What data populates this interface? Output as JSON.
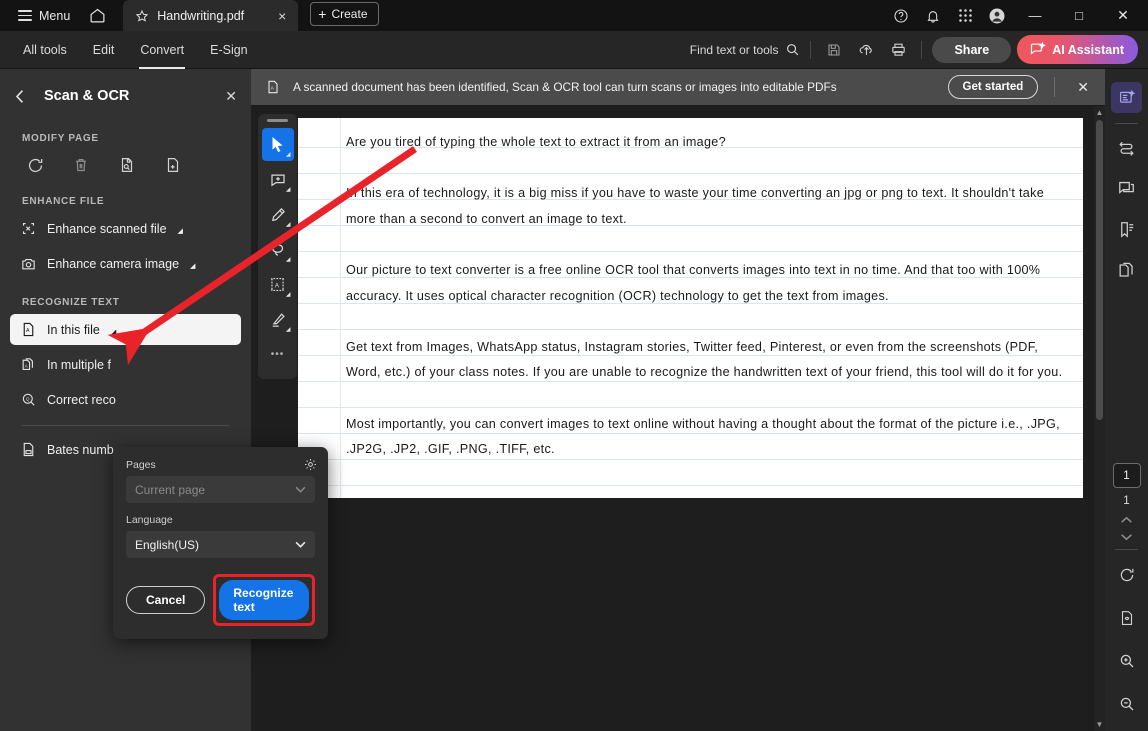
{
  "titlebar": {
    "menu_label": "Menu",
    "home_icon": "home-icon",
    "tab": {
      "star_icon": "star-icon",
      "title": "Handwriting.pdf",
      "close": "×"
    },
    "create_label": "Create",
    "plus": "+",
    "right_icons": [
      "help-icon",
      "bell-icon",
      "apps-grid-icon",
      "account-avatar-icon"
    ],
    "window_controls": {
      "minimize": "—",
      "maximize": "□",
      "close": "✕"
    }
  },
  "toolbar": {
    "tabs": [
      {
        "label": "All tools",
        "active": false
      },
      {
        "label": "Edit",
        "active": false
      },
      {
        "label": "Convert",
        "active": true
      },
      {
        "label": "E-Sign",
        "active": false
      }
    ],
    "find_label": "Find text or tools",
    "search_icon": "search-icon",
    "save_icon": "save-icon",
    "upload_icon": "cloud-upload-icon",
    "print_icon": "print-icon",
    "share_label": "Share",
    "ai_label": "AI Assistant",
    "ai_icon": "ai-sparkle-icon",
    "accent_blue": "#1473e6",
    "highlight_red": "#e8242a"
  },
  "left_panel": {
    "back_icon": "chevron-left-icon",
    "title": "Scan & OCR",
    "close": "✕",
    "sections": [
      {
        "label": "MODIFY PAGE",
        "icons": [
          "rotate-page-icon",
          "delete-page-icon",
          "replace-page-icon",
          "insert-page-icon"
        ]
      },
      {
        "label": "ENHANCE FILE",
        "items": [
          {
            "label": "Enhance scanned file",
            "icon": "enhance-scan-icon",
            "caret": true
          },
          {
            "label": "Enhance camera image",
            "icon": "camera-icon",
            "caret": true
          }
        ]
      },
      {
        "label": "RECOGNIZE TEXT",
        "items": [
          {
            "label": "In this file",
            "icon": "recognize-file-icon",
            "caret": true,
            "selected": true
          },
          {
            "label": "In multiple f",
            "icon": "recognize-multi-icon",
            "caret": false,
            "selected": false
          },
          {
            "label": "Correct reco",
            "icon": "correct-recognition-icon",
            "caret": false,
            "selected": false
          }
        ]
      },
      {
        "label": "",
        "items": [
          {
            "label": "Bates numb",
            "icon": "bates-numbering-icon",
            "caret": false,
            "selected": false
          }
        ]
      }
    ]
  },
  "popup": {
    "gear_icon": "gear-icon",
    "pages_label": "Pages",
    "pages_value": "Current page",
    "language_label": "Language",
    "language_value": "English(US)",
    "cancel_label": "Cancel",
    "recognize_label": "Recognize text",
    "chevron": "⌄"
  },
  "banner": {
    "icon": "scanned-doc-icon",
    "text": "A scanned document has been identified, Scan & OCR tool can turn scans or images into editable PDFs",
    "button_label": "Get started",
    "close": "✕"
  },
  "viewer_tools": [
    {
      "name": "select-cursor-tool",
      "active": true,
      "caret": true
    },
    {
      "name": "add-comment-tool",
      "active": false,
      "caret": true
    },
    {
      "name": "highlight-pen-tool",
      "active": false,
      "caret": true
    },
    {
      "name": "lasso-erase-tool",
      "active": false,
      "caret": true
    },
    {
      "name": "text-select-tool",
      "active": false,
      "caret": true
    },
    {
      "name": "stamp-signature-tool",
      "active": false,
      "caret": true
    },
    {
      "name": "more-tools",
      "active": false,
      "caret": false,
      "glyph": "•••"
    }
  ],
  "document": {
    "paragraphs": [
      "Are you tired of typing the whole text to extract it from an image?",
      "In this era of technology, it is a big miss if you have to waste your time converting an jpg or png to text. It shouldn't take more than a second to convert an image to text.",
      "Our picture to text converter is a free online OCR tool that converts images into text in no time. And that too with 100% accuracy. It uses optical character recognition (OCR) technology to get the text from images.",
      "Get text from Images, WhatsApp status, Instagram stories, Twitter feed, Pinterest, or even from the screenshots (PDF, Word, etc.) of your class notes. If you are unable to recognize the handwritten text of your friend, this tool will do it for you.",
      "Most importantly, you can convert images to text online without having a thought about the format of the picture i.e., .JPG, .JP2G, .JP2, .GIF, .PNG, .TIFF, etc."
    ]
  },
  "right_rail": {
    "top_icons": [
      {
        "name": "ai-assistant-panel-icon",
        "active": true
      },
      {
        "name": "convert-arrows-icon",
        "active": false
      },
      {
        "name": "comments-panel-icon",
        "active": false
      },
      {
        "name": "bookmarks-panel-icon",
        "active": false
      },
      {
        "name": "page-thumbnails-icon",
        "active": false
      }
    ],
    "current_page": "1",
    "total_pages": "1",
    "prev_icon": "chevron-up-icon",
    "next_icon": "chevron-down-icon",
    "bottom_icons": [
      {
        "name": "rotate-view-icon"
      },
      {
        "name": "fit-page-icon"
      },
      {
        "name": "zoom-in-icon"
      },
      {
        "name": "zoom-out-icon"
      }
    ]
  },
  "annotation": {
    "arrow_color": "#e8242a",
    "from": "top-right",
    "to": "in-this-file-button"
  }
}
